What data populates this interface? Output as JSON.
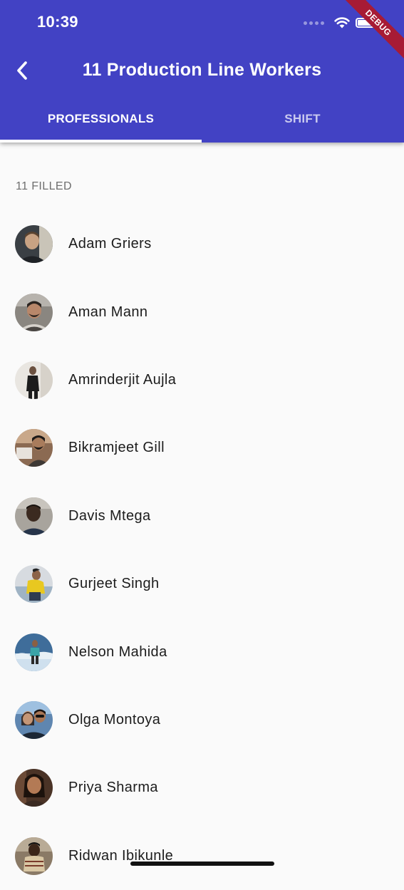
{
  "status_bar": {
    "time": "10:39",
    "debug_label": "DEBUG"
  },
  "header": {
    "title": "11 Production Line Workers",
    "back_icon": "chevron-left-icon"
  },
  "tabs": [
    {
      "label": "PROFESSIONALS",
      "active": true
    },
    {
      "label": "SHIFT",
      "active": false
    }
  ],
  "list": {
    "section_label": "11 FILLED",
    "workers": [
      {
        "name": "Adam Griers"
      },
      {
        "name": "Aman Mann"
      },
      {
        "name": "Amrinderjit Aujla"
      },
      {
        "name": "Bikramjeet Gill"
      },
      {
        "name": "Davis Mtega"
      },
      {
        "name": "Gurjeet Singh"
      },
      {
        "name": "Nelson Mahida"
      },
      {
        "name": "Olga Montoya"
      },
      {
        "name": "Priya Sharma"
      },
      {
        "name": "Ridwan Ibikunle"
      }
    ]
  },
  "colors": {
    "primary": "#4242c4",
    "background": "#fafafa",
    "debug_banner": "#a71b35"
  }
}
